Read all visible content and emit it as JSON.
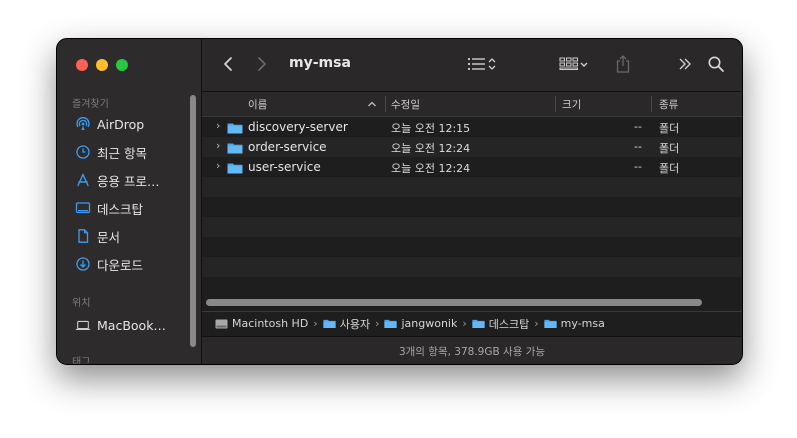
{
  "window": {
    "title": "my-msa"
  },
  "sidebar": {
    "favorites_label": "즐겨찾기",
    "favorites": [
      {
        "label": "AirDrop",
        "icon": "airdrop-icon"
      },
      {
        "label": "최근 항목",
        "icon": "clock-icon"
      },
      {
        "label": "응용 프로…",
        "icon": "applications-icon"
      },
      {
        "label": "데스크탑",
        "icon": "desktop-icon"
      },
      {
        "label": "문서",
        "icon": "document-icon"
      },
      {
        "label": "다운로드",
        "icon": "download-icon"
      }
    ],
    "locations_label": "위치",
    "locations": [
      {
        "label": "MacBook…",
        "icon": "laptop-icon"
      }
    ],
    "tags_label": "태그"
  },
  "columns": {
    "name": "이름",
    "date": "수정일",
    "size": "크기",
    "kind": "종류"
  },
  "files": [
    {
      "name": "discovery-server",
      "date": "오늘 오전 12:15",
      "size": "--",
      "kind": "폴더"
    },
    {
      "name": "order-service",
      "date": "오늘 오전 12:24",
      "size": "--",
      "kind": "폴더"
    },
    {
      "name": "user-service",
      "date": "오늘 오전 12:24",
      "size": "--",
      "kind": "폴더"
    }
  ],
  "path": [
    {
      "label": "Macintosh HD",
      "icon": "disk-icon"
    },
    {
      "label": "사용자",
      "icon": "folder-icon"
    },
    {
      "label": "jangwonik",
      "icon": "folder-icon"
    },
    {
      "label": "데스크탑",
      "icon": "folder-icon"
    },
    {
      "label": "my-msa",
      "icon": "folder-icon"
    }
  ],
  "status": "3개의 항목, 378.9GB 사용 가능",
  "colors": {
    "accent": "#2f8ff0",
    "folder": "#5ab3f5",
    "sidebar": "#2d2b2c",
    "content": "#1e1e1e"
  }
}
